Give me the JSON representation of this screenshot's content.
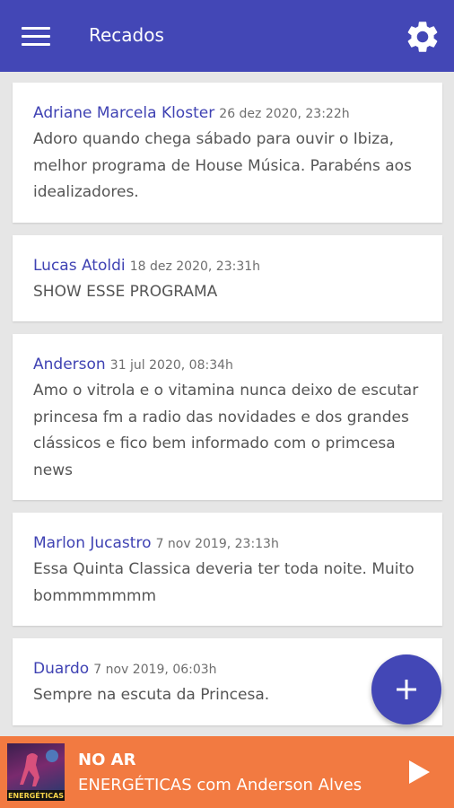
{
  "appbar": {
    "title": "Recados",
    "menu_icon": "menu-icon",
    "settings_icon": "gear-icon"
  },
  "messages": [
    {
      "name": "Adriane Marcela Kloster",
      "date": "26 dez 2020, 23:22h",
      "text": "Adoro quando chega sábado para ouvir o Ibiza, melhor programa de House Música. Parabéns aos idealizadores."
    },
    {
      "name": "Lucas Atoldi",
      "date": "18 dez 2020, 23:31h",
      "text": "SHOW ESSE PROGRAMA"
    },
    {
      "name": "Anderson",
      "date": "31 jul 2020, 08:34h",
      "text": "Amo o vitrola e o vitamina nunca deixo de escutar princesa fm a radio das novidades e dos grandes clássicos e fico bem informado com o primcesa news"
    },
    {
      "name": "Marlon Jucastro",
      "date": "7 nov 2019, 23:13h",
      "text": "Essa Quinta Classica deveria ter toda noite. Muito bommmmmmm"
    },
    {
      "name": "Duardo",
      "date": "7 nov 2019, 06:03h",
      "text": "Sempre na escuta da Princesa."
    }
  ],
  "fab": {
    "icon": "plus-icon"
  },
  "player": {
    "status": "NO AR",
    "program": "ENERGÉTICAS com Anderson Alves",
    "thumb_label": "ENERGÉTICAS",
    "play_icon": "play-icon"
  },
  "colors": {
    "primary": "#4347b6",
    "player": "#f27a41",
    "name": "#3f42b3",
    "background": "#e6e6e6"
  }
}
